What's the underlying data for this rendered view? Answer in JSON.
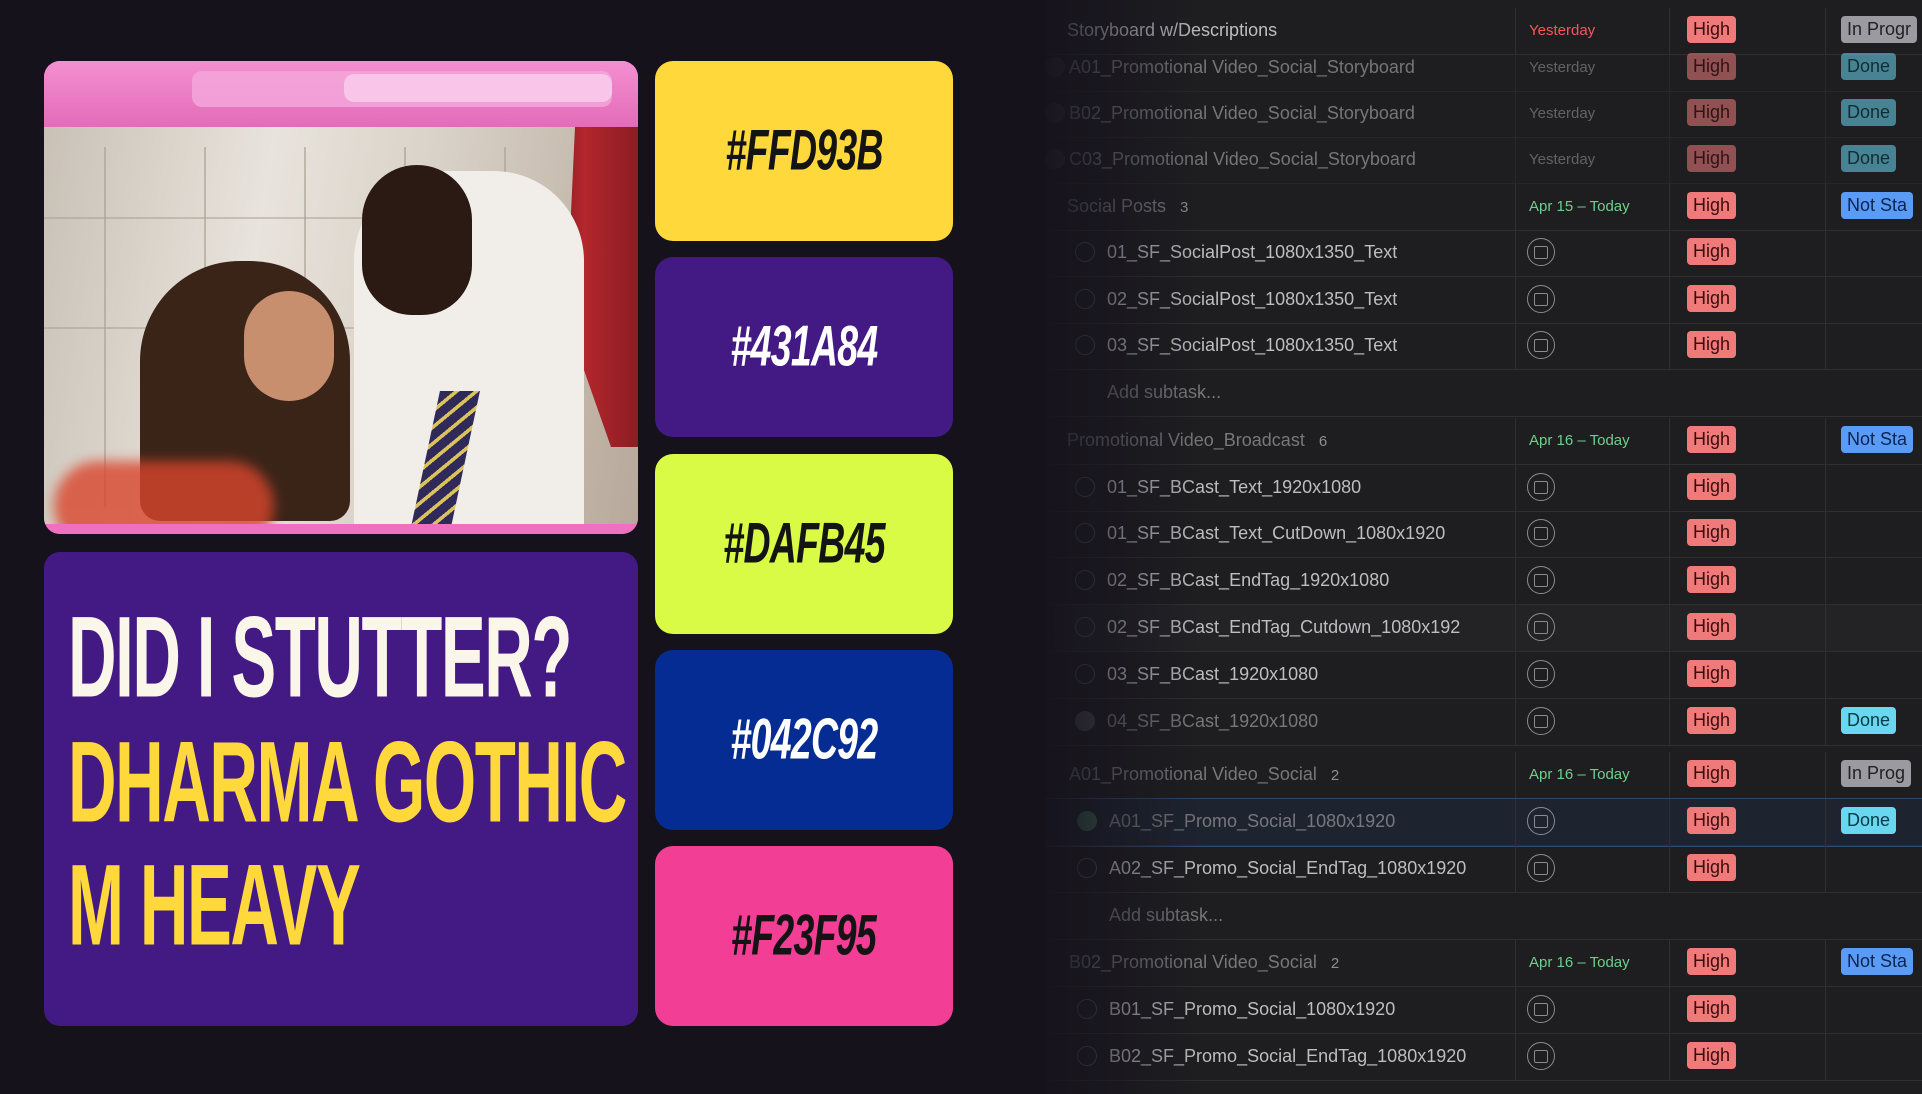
{
  "board": {
    "headline": {
      "line1": "DID I STUTTER?",
      "line2": "DHARMA GOTHIC",
      "line3": "M HEAVY"
    },
    "swatches": [
      {
        "label": "#FFD93B",
        "bg": "#FFD93B",
        "fg": "#141414"
      },
      {
        "label": "#431A84",
        "bg": "#431A84",
        "fg": "#FFFFFF"
      },
      {
        "label": "#DAFB45",
        "bg": "#DAFB45",
        "fg": "#141414"
      },
      {
        "label": "#042C92",
        "bg": "#042C92",
        "fg": "#FFFFFF"
      },
      {
        "label": "#F23F95",
        "bg": "#F23F95",
        "fg": "#141414"
      }
    ]
  },
  "tasks": {
    "rows": [
      {
        "name": "Storyboard w/Descriptions",
        "date": "Yesterday",
        "prio": "High",
        "status": "In Progr"
      },
      {
        "name": "A01_Promotional Video_Social_Storyboard",
        "date": "Yesterday",
        "prio": "High",
        "status": "Done"
      },
      {
        "name": "B02_Promotional Video_Social_Storyboard",
        "date": "Yesterday",
        "prio": "High",
        "status": "Done"
      },
      {
        "name": "C03_Promotional Video_Social_Storyboard",
        "date": "Yesterday",
        "prio": "High",
        "status": "Done"
      },
      {
        "name": "Social Posts",
        "count": "3",
        "date": "Apr 15 – Today",
        "prio": "High",
        "status": "Not Sta"
      },
      {
        "name": "01_SF_SocialPost_1080x1350_Text",
        "prio": "High"
      },
      {
        "name": "02_SF_SocialPost_1080x1350_Text",
        "prio": "High"
      },
      {
        "name": "03_SF_SocialPost_1080x1350_Text",
        "prio": "High"
      },
      {
        "name": "Add subtask..."
      },
      {
        "name": "Promotional Video_Broadcast",
        "count": "6",
        "date": "Apr 16 – Today",
        "prio": "High",
        "status": "Not Sta"
      },
      {
        "name": "01_SF_BCast_Text_1920x1080",
        "prio": "High"
      },
      {
        "name": "01_SF_BCast_Text_CutDown_1080x1920",
        "prio": "High"
      },
      {
        "name": "02_SF_BCast_EndTag_1920x1080",
        "prio": "High"
      },
      {
        "name": "02_SF_BCast_EndTag_Cutdown_1080x192",
        "prio": "High"
      },
      {
        "name": "03_SF_BCast_1920x1080",
        "prio": "High"
      },
      {
        "name": "04_SF_BCast_1920x1080",
        "prio": "High",
        "status": "Done"
      },
      {
        "name": "A01_Promotional Video_Social",
        "count": "2",
        "date": "Apr 16 – Today",
        "prio": "High",
        "status": "In Prog"
      },
      {
        "name": "A01_SF_Promo_Social_1080x1920",
        "prio": "High",
        "status": "Done"
      },
      {
        "name": "A02_SF_Promo_Social_EndTag_1080x1920",
        "prio": "High"
      },
      {
        "name": "Add subtask..."
      },
      {
        "name": "B02_Promotional Video_Social",
        "count": "2",
        "date": "Apr 16 – Today",
        "prio": "High",
        "status": "Not Sta"
      },
      {
        "name": "B01_SF_Promo_Social_1080x1920",
        "prio": "High"
      },
      {
        "name": "B02_SF_Promo_Social_EndTag_1080x1920",
        "prio": "High"
      }
    ]
  }
}
